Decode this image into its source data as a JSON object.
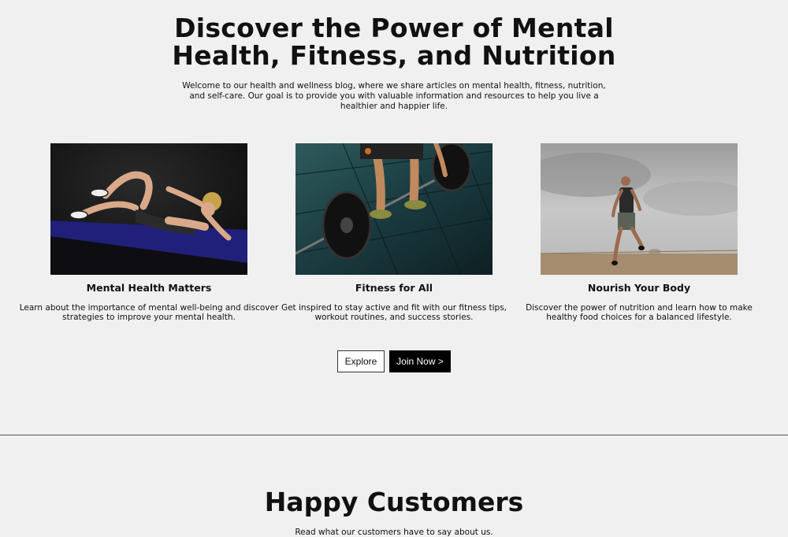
{
  "hero": {
    "title_line1": "Discover the Power of Mental",
    "title_line2": "Health, Fitness, and Nutrition",
    "subtitle": "Welcome to our health and wellness blog, where we share articles on mental health, fitness, nutrition, and self-care. Our goal is to provide you with valuable information and resources to help you live a healthier and happier life."
  },
  "cards": [
    {
      "title": "Mental Health Matters",
      "text": "Learn about the importance of mental well-being and discover strategies to improve your mental health.",
      "image": "woman-doing-crunches-on-mat"
    },
    {
      "title": "Fitness for All",
      "text": "Get inspired to stay active and fit with our fitness tips, workout routines, and success stories.",
      "image": "barbell-deadlift-on-gym-floor"
    },
    {
      "title": "Nourish Your Body",
      "text": "Discover the power of nutrition and learn how to make healthy food choices for a balanced lifestyle.",
      "image": "man-running-on-desert-track"
    }
  ],
  "buttons": {
    "explore": "Explore",
    "join": "Join Now >"
  },
  "testimonials": {
    "title": "Happy Customers",
    "subtitle": "Read what our customers have to say about us."
  }
}
